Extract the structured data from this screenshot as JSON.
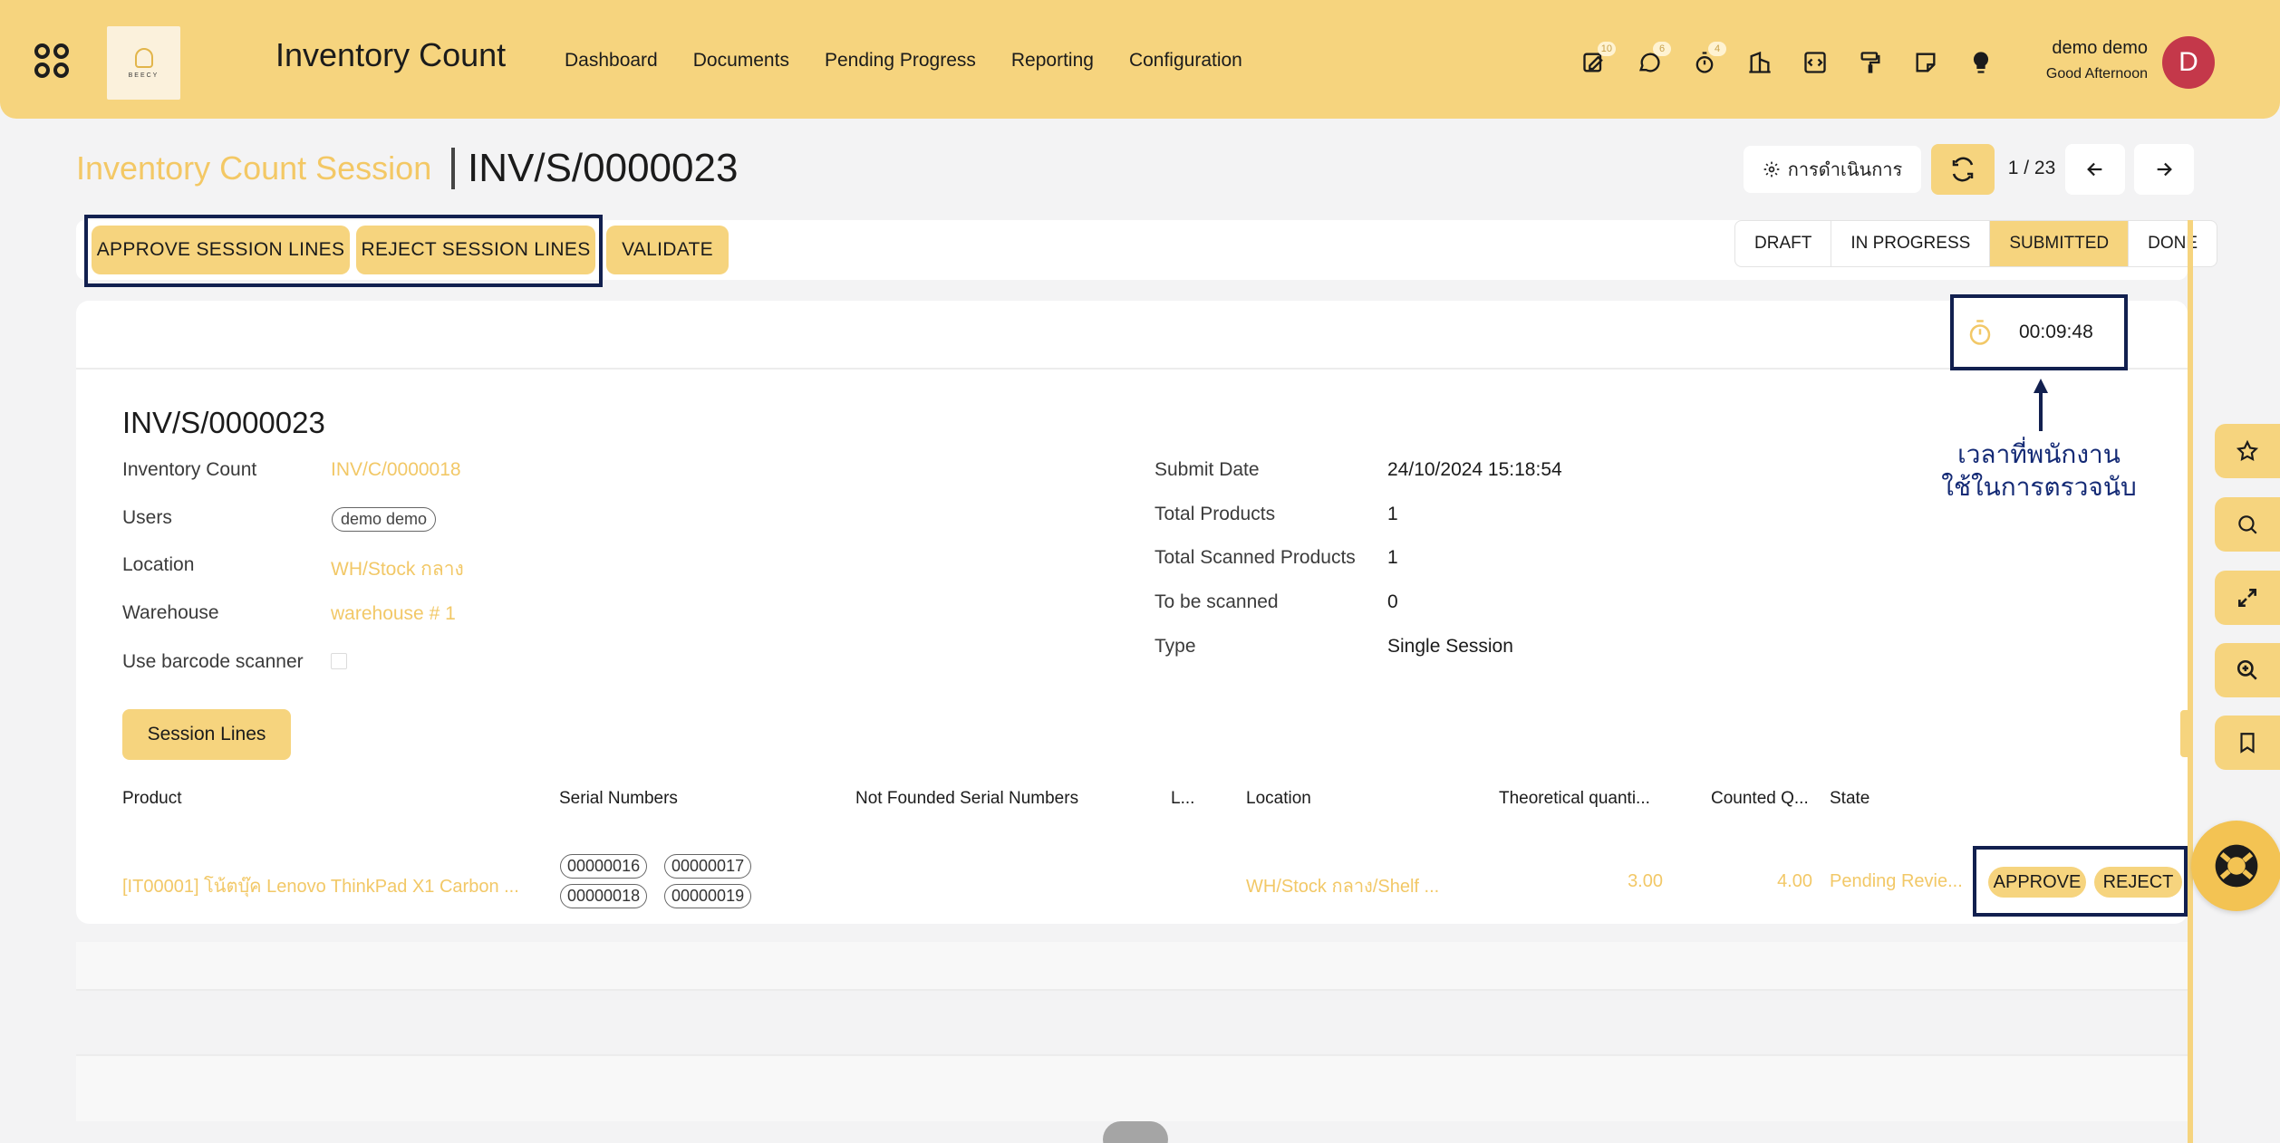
{
  "app": {
    "title": "Inventory Count",
    "logo_text": "BEECY",
    "nav": [
      "Dashboard",
      "Documents",
      "Pending Progress",
      "Reporting",
      "Configuration"
    ],
    "badges": {
      "activity": "10",
      "messages": "6",
      "timer": "4"
    },
    "user": {
      "name": "demo demo",
      "greeting": "Good Afternoon",
      "initial": "D"
    }
  },
  "breadcrumb": {
    "parent": "Inventory Count Session",
    "current": "INV/S/0000023"
  },
  "control": {
    "action_label": "การดำเนินการ",
    "pager": "1 / 23"
  },
  "statusbar": {
    "buttons": {
      "approve_lines": "APPROVE SESSION LINES",
      "reject_lines": "REJECT SESSION LINES",
      "validate": "VALIDATE"
    },
    "stages": [
      "DRAFT",
      "IN PROGRESS",
      "SUBMITTED",
      "DONE"
    ],
    "active_stage": "SUBMITTED"
  },
  "timer": {
    "value": "00:09:48"
  },
  "annotation": {
    "line1": "เวลาที่พนักงาน",
    "line2": "ใช้ในการตรวจนับ"
  },
  "record": {
    "title": "INV/S/0000023",
    "left": {
      "inventory_count_label": "Inventory Count",
      "inventory_count_value": "INV/C/0000018",
      "users_label": "Users",
      "users_value": "demo demo",
      "location_label": "Location",
      "location_value": "WH/Stock กลาง",
      "warehouse_label": "Warehouse",
      "warehouse_value": "warehouse # 1",
      "barcode_label": "Use barcode scanner"
    },
    "right": {
      "submit_date_label": "Submit Date",
      "submit_date_value": "24/10/2024 15:18:54",
      "total_products_label": "Total Products",
      "total_products_value": "1",
      "total_scanned_label": "Total Scanned Products",
      "total_scanned_value": "1",
      "to_be_scanned_label": "To be scanned",
      "to_be_scanned_value": "0",
      "type_label": "Type",
      "type_value": "Single Session"
    },
    "tab": "Session Lines"
  },
  "table": {
    "headers": {
      "product": "Product",
      "serials": "Serial Numbers",
      "not_found": "Not Founded Serial Numbers",
      "lot": "L...",
      "location": "Location",
      "theoretical": "Theoretical quanti...",
      "counted": "Counted Q...",
      "state": "State"
    },
    "rows": [
      {
        "product": "[IT00001] โน้ตบุ๊ค Lenovo ThinkPad X1 Carbon ...",
        "serials": [
          "00000016",
          "00000017",
          "00000018",
          "00000019"
        ],
        "location": "WH/Stock กลาง/Shelf ...",
        "theoretical": "3.00",
        "counted": "4.00",
        "state": "Pending Revie...",
        "approve": "APPROVE",
        "reject": "REJECT"
      }
    ]
  }
}
